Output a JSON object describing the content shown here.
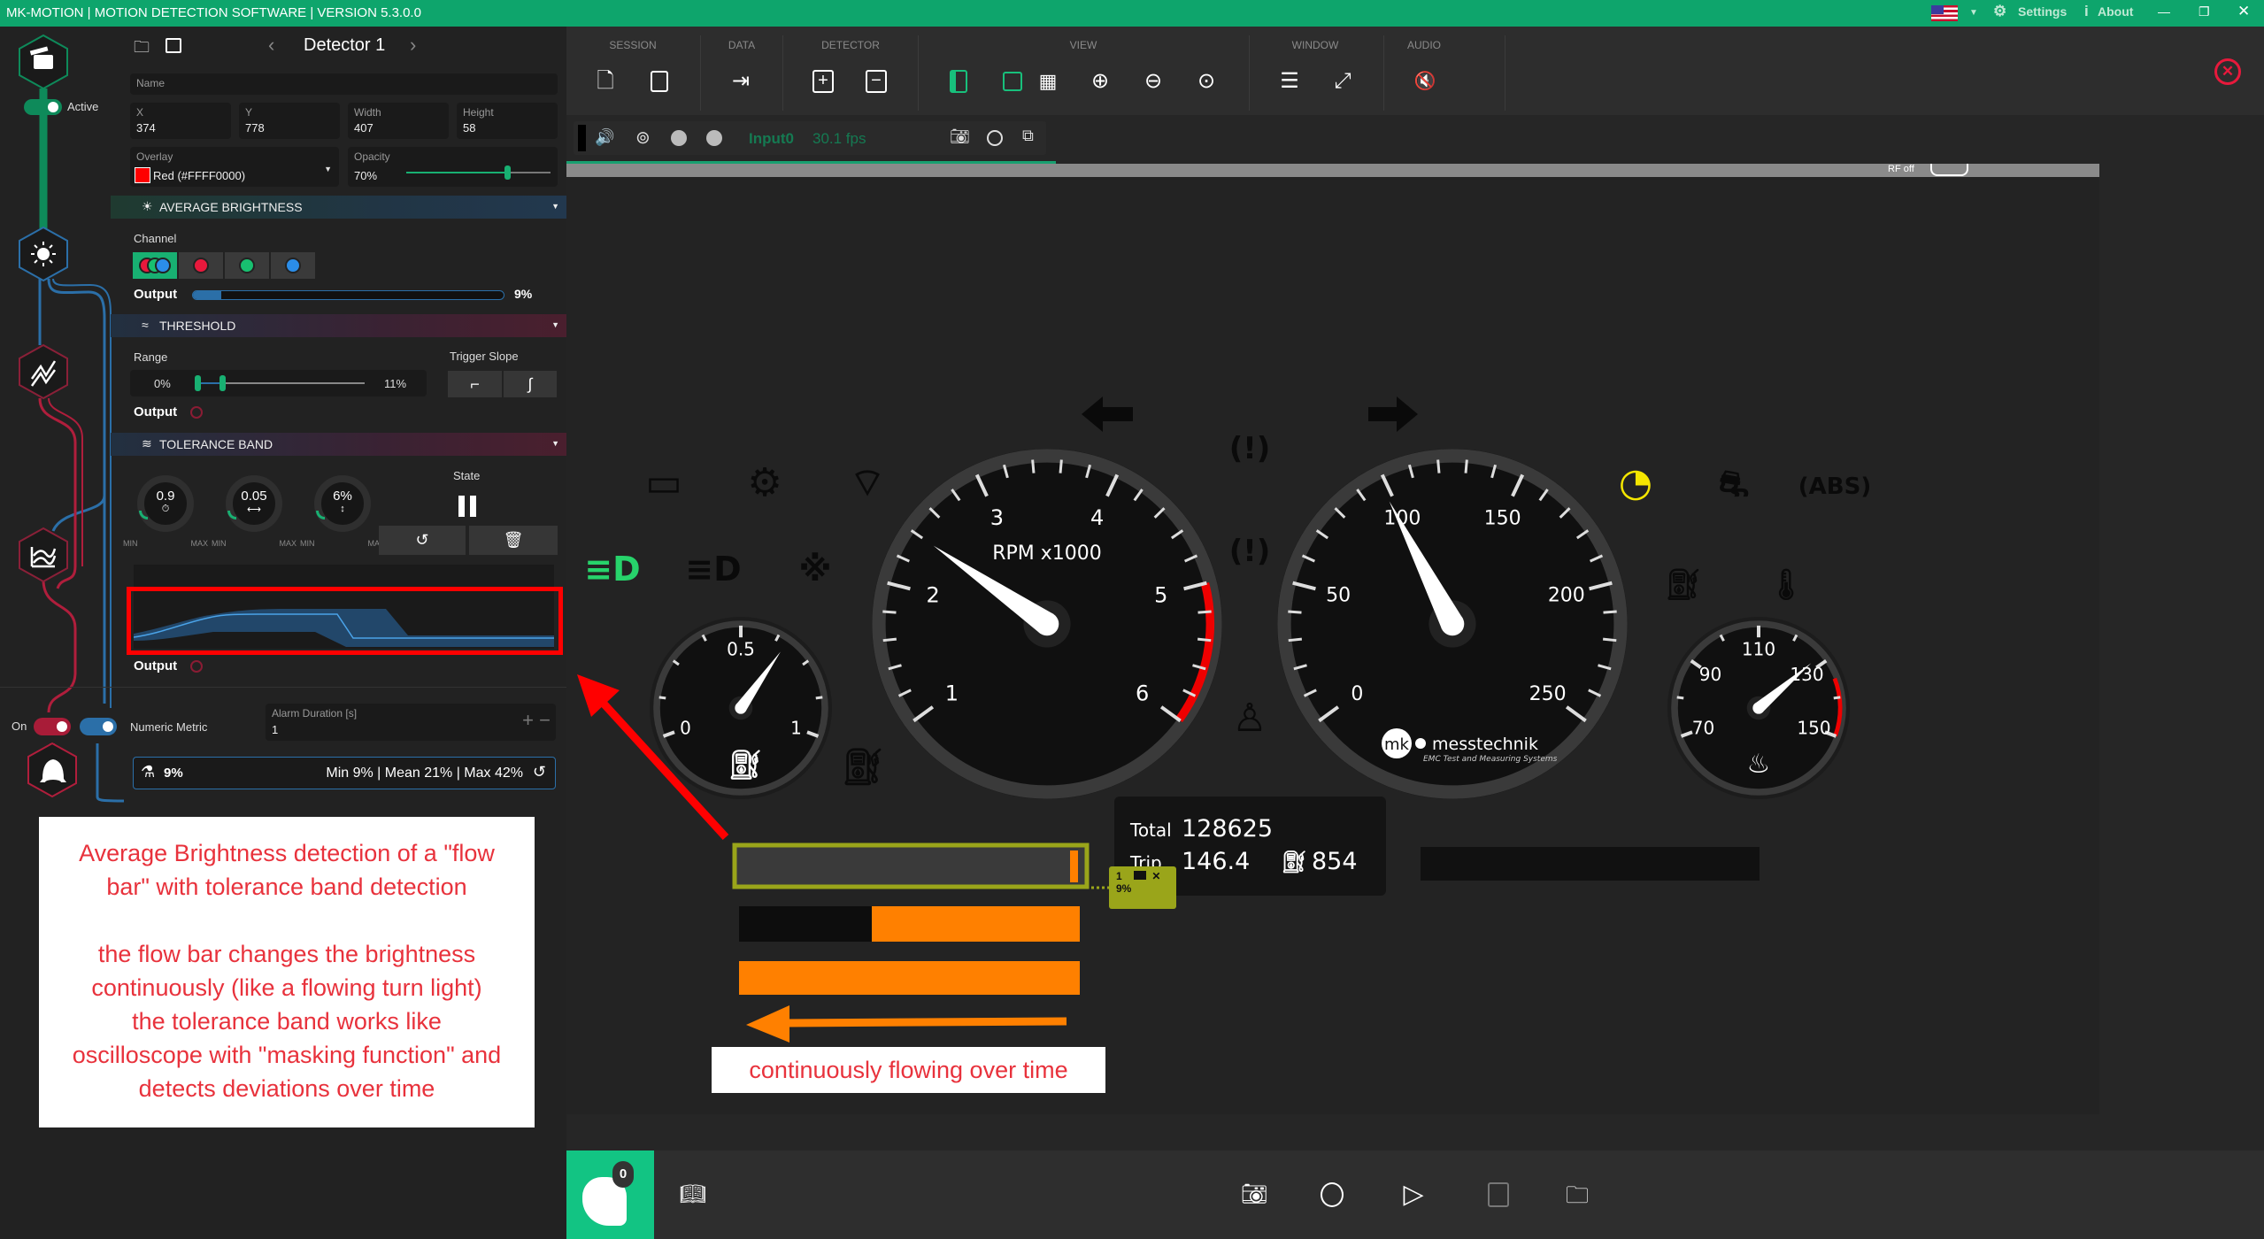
{
  "titlebar": {
    "title": "MK-MOTION | MOTION DETECTION SOFTWARE | VERSION 5.3.0.0",
    "settings": "Settings",
    "about": "About",
    "language_flag": "us-flag"
  },
  "rail": {
    "active_label": "Active",
    "on_label": "On",
    "nodes": [
      "image-source",
      "average-brightness",
      "threshold",
      "tolerance-band",
      "alarm"
    ]
  },
  "detector": {
    "title": "Detector 1",
    "name_label": "Name",
    "name_value": "",
    "x_label": "X",
    "x": "374",
    "y_label": "Y",
    "y": "778",
    "width_label": "Width",
    "width": "407",
    "height_label": "Height",
    "height": "58",
    "overlay_label": "Overlay",
    "overlay_value": "Red (#FFFF0000)",
    "overlay_color": "#FF0000",
    "opacity_label": "Opacity",
    "opacity": "70%",
    "opacity_value": 70
  },
  "brightness": {
    "header": "AVERAGE BRIGHTNESS",
    "channel_label": "Channel",
    "channels": [
      "rgb",
      "red",
      "green",
      "blue"
    ],
    "selected_channel": "rgb",
    "output_label": "Output",
    "output": "9%",
    "output_value": 9
  },
  "threshold": {
    "header": "THRESHOLD",
    "range_label": "Range",
    "range_min": "0%",
    "range_max": "11%",
    "trigger_slope_label": "Trigger Slope",
    "output_label": "Output"
  },
  "tolerance": {
    "header": "TOLERANCE BAND",
    "knobs": [
      {
        "value": "0.9",
        "icon": "stopwatch-icon",
        "min": "MIN",
        "max": "MAX"
      },
      {
        "value": "0.05",
        "icon": "width-icon",
        "min": "MIN",
        "max": "MAX"
      },
      {
        "value": "6%",
        "icon": "height-icon",
        "min": "MIN",
        "max": "MAX"
      }
    ],
    "state_label": "State",
    "output_label": "Output"
  },
  "alarm": {
    "numeric_metric": "Numeric Metric",
    "duration_label": "Alarm Duration [s]",
    "duration": "1",
    "plus": "+",
    "minus": "−"
  },
  "metric": {
    "current": "9%",
    "summary": "Min 9% | Mean 21% | Max 42%"
  },
  "toolbar": {
    "groups": [
      "SESSION",
      "DATA",
      "DETECTOR",
      "VIEW",
      "WINDOW",
      "AUDIO"
    ]
  },
  "stream": {
    "input": "Input0",
    "fps": "30.1 fps",
    "rf_label": "RF off"
  },
  "dashboard": {
    "rpm": {
      "title": "RPM x1000",
      "labels": [
        "1",
        "2",
        "3",
        "4",
        "5",
        "6"
      ],
      "value": 2.4
    },
    "speed": {
      "labels": [
        "0",
        "50",
        "100",
        "150",
        "200",
        "250"
      ],
      "value": 98
    },
    "fuel": {
      "labels": [
        "0",
        "0.5",
        "1"
      ],
      "value": 0.66
    },
    "temp": {
      "labels": [
        "70",
        "90",
        "110",
        "130",
        "150"
      ],
      "value": 128
    },
    "total_label": "Total",
    "total": "128625",
    "trip_label": "Trip",
    "trip": "146.4",
    "range": "854",
    "logo": {
      "mk": "mk",
      "name": "messtechnik",
      "tagline": "EMC Test and Measuring Systems"
    },
    "detection_tag": {
      "id": "1",
      "value": "9%"
    },
    "colors": {
      "orange": "#ff8000",
      "detect": "#9aa51a",
      "headlight": "#27d36b",
      "cruise": "#f5e600"
    }
  },
  "annotations": {
    "note_lines": [
      "Average Brightness detection of a \"flow",
      "bar\" with tolerance band detection",
      "",
      "the flow bar changes the brightness",
      "continuously (like a flowing turn light)",
      "the tolerance band works like",
      "oscilloscope with \"masking function\" and",
      "detects deviations over time"
    ],
    "flow_label": "continuously flowing over time"
  },
  "bottombar": {
    "alarm_count": "0"
  }
}
